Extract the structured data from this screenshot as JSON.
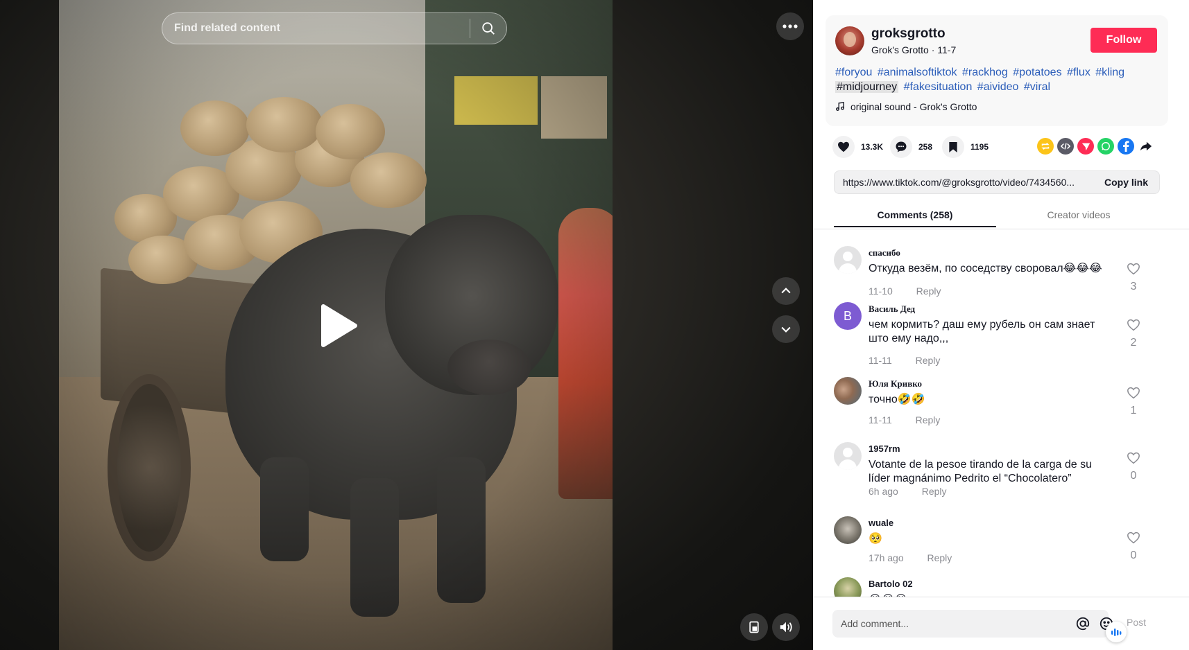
{
  "video": {
    "search_placeholder": "Find related content",
    "icons": [
      "search-icon",
      "more-icon",
      "arrow-up-icon",
      "arrow-down-icon",
      "play-icon",
      "pip-icon",
      "volume-icon"
    ]
  },
  "author": {
    "username": "groksgrotto",
    "subtitle": "Grok's Grotto · 11-7",
    "follow_label": "Follow"
  },
  "description": {
    "tags": [
      "#foryou",
      "#animalsoftiktok",
      "#rackhog",
      "#potatoes",
      "#flux",
      "#kling",
      "#midjourney",
      "#fakesituation",
      "#aivideo",
      "#viral"
    ],
    "highlighted_tag": "#midjourney",
    "sound": "original sound - Grok's Grotto"
  },
  "stats": {
    "likes": "13.3K",
    "comments": "258",
    "saves": "1195"
  },
  "share_colors": {
    "repost": "#fcc419",
    "embed": "#5b5b66",
    "send": "#fe2c55",
    "whatsapp": "#25d366",
    "facebook": "#1877f2",
    "share": "#161823"
  },
  "link": {
    "url": "https://www.tiktok.com/@groksgrotto/video/7434560...",
    "copy_label": "Copy link"
  },
  "tabs": {
    "comments_label": "Comments (258)",
    "creator_label": "Creator videos"
  },
  "comments": [
    {
      "user": "спасибо",
      "text": "Откуда везём, по соседству своровал😂😂😂",
      "date": "11-10",
      "reply": "Reply",
      "likes": "3"
    },
    {
      "user": "Василь Дед",
      "avatar_letter": "B",
      "text": "чем кормить? даш ему рубель он сам знает што ему надо,,,",
      "date": "11-11",
      "reply": "Reply",
      "likes": "2"
    },
    {
      "user": "Юля Кривко",
      "text": "точно🤣🤣",
      "date": "11-11",
      "reply": "Reply",
      "likes": "1"
    },
    {
      "user": "1957rm",
      "text": "Votante de la pesoe tirando de la carga de su líder magnánimo Pedrito el “Chocolatero”",
      "date": "6h ago",
      "reply": "Reply",
      "likes": "0"
    },
    {
      "user": "wuale",
      "text": "🥺",
      "date": "17h ago",
      "reply": "Reply",
      "likes": "0"
    },
    {
      "user": "Bartolo 02",
      "text": "😂😂😂",
      "date": "",
      "reply": "",
      "likes": ""
    }
  ],
  "composer": {
    "placeholder": "Add comment...",
    "post_label": "Post"
  }
}
